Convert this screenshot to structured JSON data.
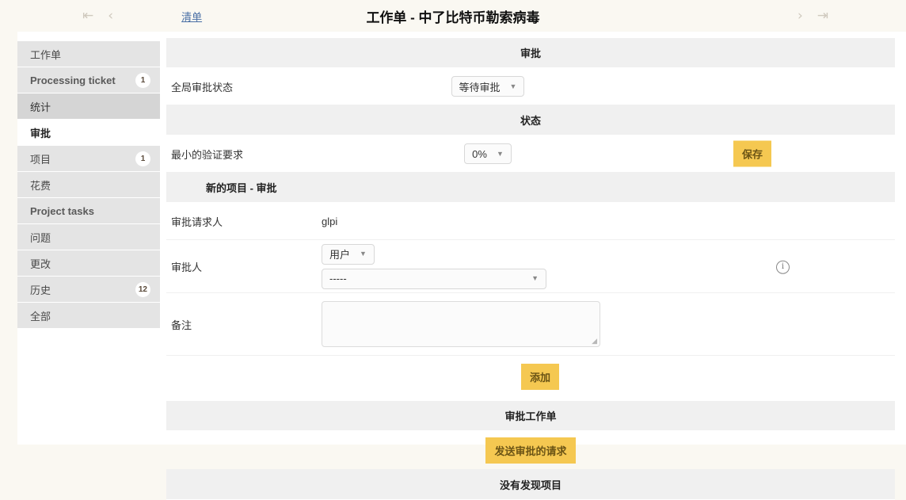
{
  "topbar": {
    "first_icon": "first-page-icon",
    "prev_icon": "previous-page-icon",
    "list_link": "清单",
    "title": "工作单 - 中了比特币勒索病毒",
    "next_icon": "next-page-icon",
    "last_icon": "last-page-icon"
  },
  "sidebar": {
    "items": [
      {
        "label": "工作单",
        "badge": "",
        "state": "normal",
        "script": "cjk"
      },
      {
        "label": "Processing ticket",
        "badge": "1",
        "state": "normal",
        "script": "latin"
      },
      {
        "label": "统计",
        "badge": "",
        "state": "active",
        "script": "cjk"
      },
      {
        "label": "审批",
        "badge": "",
        "state": "current",
        "script": "cjk"
      },
      {
        "label": "项目",
        "badge": "1",
        "state": "normal",
        "script": "cjk"
      },
      {
        "label": "花费",
        "badge": "",
        "state": "normal",
        "script": "cjk"
      },
      {
        "label": "Project tasks",
        "badge": "",
        "state": "normal",
        "script": "latin"
      },
      {
        "label": "问题",
        "badge": "",
        "state": "normal",
        "script": "cjk"
      },
      {
        "label": "更改",
        "badge": "",
        "state": "normal",
        "script": "cjk"
      },
      {
        "label": "历史",
        "badge": "12",
        "state": "normal",
        "script": "cjk"
      },
      {
        "label": "全部",
        "badge": "",
        "state": "normal",
        "script": "cjk"
      }
    ]
  },
  "main": {
    "approval_section": {
      "header": "审批",
      "global_status_label": "全局审批状态",
      "global_status_value": "等待审批"
    },
    "status_section": {
      "header": "状态",
      "min_validation_label": "最小的验证要求",
      "min_validation_value": "0%",
      "save_label": "保存"
    },
    "new_item_section": {
      "header": "新的项目 - 审批",
      "requester_label": "审批请求人",
      "requester_value": "glpi",
      "approver_label": "审批人",
      "approver_type_value": "用户",
      "approver_value": "-----",
      "info_icon": "info-circle-icon",
      "comment_label": "备注",
      "comment_value": "",
      "comment_placeholder": "",
      "add_label": "添加"
    },
    "approval_ticket_section": {
      "header": "审批工作单",
      "send_request_label": "发送审批的请求",
      "empty_message": "没有发现项目"
    }
  },
  "colors": {
    "accent_amber": "#f5c851",
    "page_background": "#faf8f2",
    "sidebar_item": "#e4e4e4",
    "section_header": "#f0f0f0",
    "link_blue": "#4a6fa5"
  }
}
